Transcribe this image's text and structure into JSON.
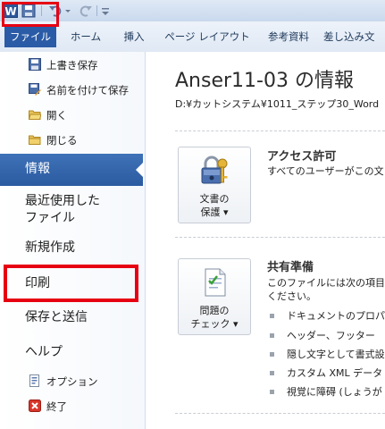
{
  "app_icon_letter": "W",
  "tabs": {
    "file": "ファイル",
    "home": "ホーム",
    "insert": "挿入",
    "page_layout": "ページ レイアウト",
    "references": "参考資料",
    "mailings": "差し込み文"
  },
  "nav": {
    "save": "上書き保存",
    "save_as": "名前を付けて保存",
    "open": "開く",
    "close": "閉じる",
    "info": "情報",
    "recent_line1": "最近使用した",
    "recent_line2": "ファイル",
    "new": "新規作成",
    "print": "印刷",
    "save_send": "保存と送信",
    "help": "ヘルプ",
    "options": "オプション",
    "exit": "終了"
  },
  "main": {
    "title": "Anser11-03 の情報",
    "path": "D:¥カットシステム¥1011_ステップ30_Word",
    "protect": {
      "button_line1": "文書の",
      "button_line2": "保護 ▾",
      "heading": "アクセス許可",
      "desc": "すべてのユーザーがこの文"
    },
    "check": {
      "button_line1": "問題の",
      "button_line2": "チェック ▾",
      "heading": "共有準備",
      "desc_line1": "このファイルには次の項目が",
      "desc_line2": "ください。",
      "bullets": [
        "ドキュメントのプロパテ",
        "ヘッダー、フッター",
        "隠し文字として書式設",
        "カスタム XML データ",
        "視覚に障碍 (しょうが"
      ]
    }
  },
  "colors": {
    "file_tab": "#2a5ba6",
    "info_selected": "#2f62ab",
    "highlight_frame": "#e60012"
  }
}
